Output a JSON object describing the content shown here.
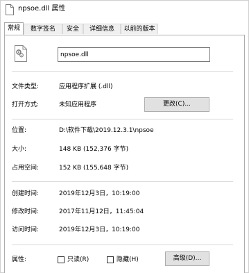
{
  "window": {
    "title": "npsoe.dll 属性",
    "title_icon": "document-icon"
  },
  "tabs": [
    {
      "label": "常规",
      "active": true
    },
    {
      "label": "数字签名",
      "active": false
    },
    {
      "label": "安全",
      "active": false
    },
    {
      "label": "详细信息",
      "active": false
    },
    {
      "label": "以前的版本",
      "active": false
    }
  ],
  "general": {
    "file_icon": "dll-file-gear-icon",
    "filename": "npsoe.dll",
    "file_type_label": "文件类型:",
    "file_type_value": "应用程序扩展 (.dll)",
    "opens_with_label": "打开方式:",
    "opens_with_value": "未知应用程序",
    "change_button": "更改(C)...",
    "location_label": "位置:",
    "location_value": "D:\\软件下载\\2019.12.3.1\\npsoe",
    "size_label": "大小:",
    "size_value": "148 KB (152,376 字节)",
    "size_on_disk_label": "占用空间:",
    "size_on_disk_value": "152 KB (155,648 字节)",
    "created_label": "创建时间:",
    "created_value": "2019年12月3日，10:19:00",
    "modified_label": "修改时间:",
    "modified_value": "2017年11月12日，11:45:04",
    "accessed_label": "访问时间:",
    "accessed_value": "2019年12月3日，10:19:00",
    "attributes_label": "属性:",
    "readonly_label": "只读(R)",
    "readonly_checked": false,
    "hidden_label": "隐藏(H)",
    "hidden_checked": false,
    "advanced_button": "高级(D)..."
  }
}
